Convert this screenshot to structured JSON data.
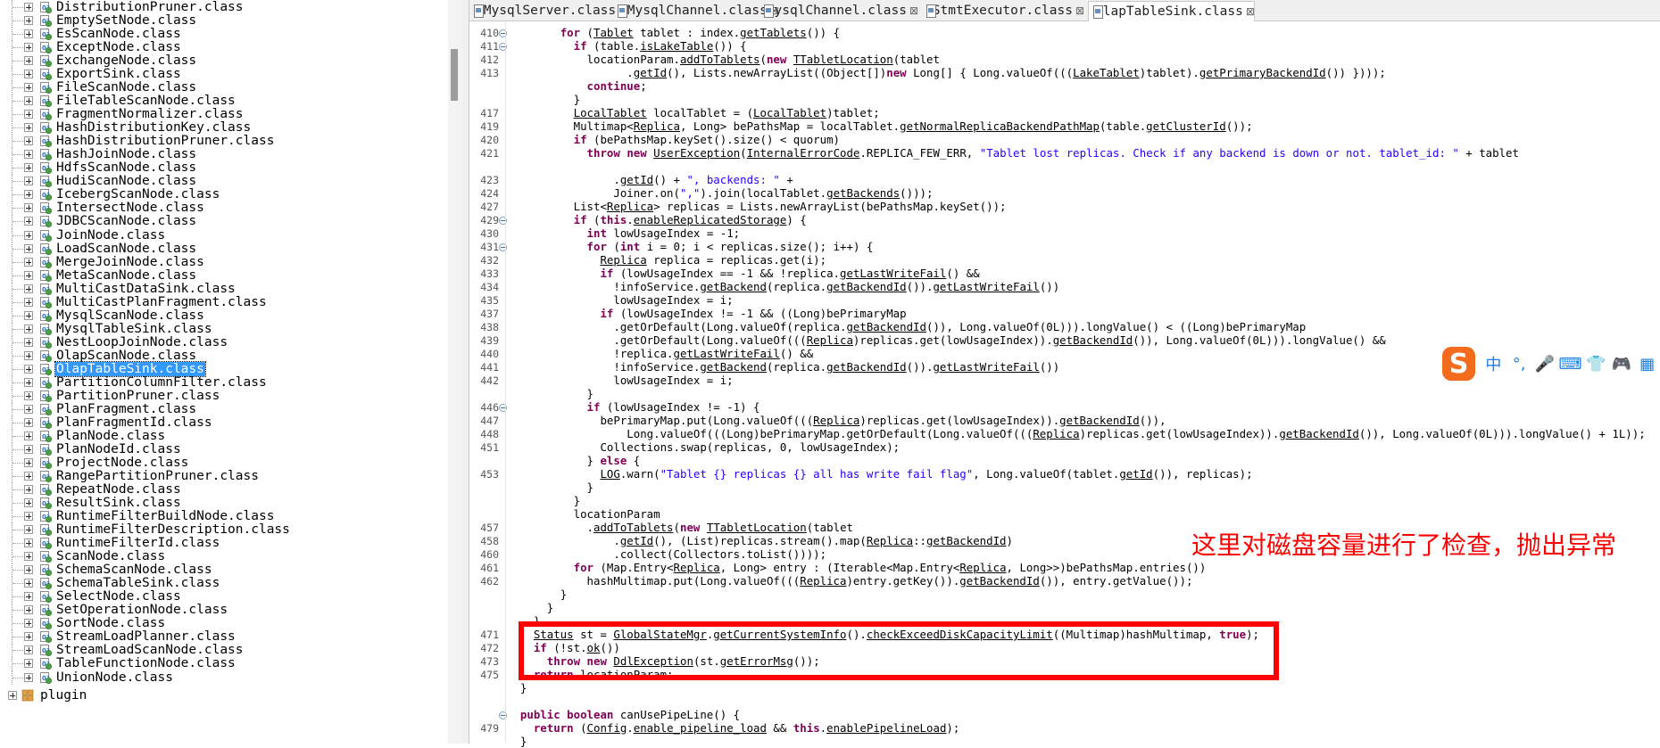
{
  "tree": {
    "items": [
      {
        "label": "DistributionPruner.class"
      },
      {
        "label": "EmptySetNode.class"
      },
      {
        "label": "EsScanNode.class"
      },
      {
        "label": "ExceptNode.class"
      },
      {
        "label": "ExchangeNode.class"
      },
      {
        "label": "ExportSink.class"
      },
      {
        "label": "FileScanNode.class"
      },
      {
        "label": "FileTableScanNode.class"
      },
      {
        "label": "FragmentNormalizer.class"
      },
      {
        "label": "HashDistributionKey.class"
      },
      {
        "label": "HashDistributionPruner.class"
      },
      {
        "label": "HashJoinNode.class"
      },
      {
        "label": "HdfsScanNode.class"
      },
      {
        "label": "HudiScanNode.class"
      },
      {
        "label": "IcebergScanNode.class"
      },
      {
        "label": "IntersectNode.class"
      },
      {
        "label": "JDBCScanNode.class"
      },
      {
        "label": "JoinNode.class"
      },
      {
        "label": "LoadScanNode.class"
      },
      {
        "label": "MergeJoinNode.class"
      },
      {
        "label": "MetaScanNode.class"
      },
      {
        "label": "MultiCastDataSink.class"
      },
      {
        "label": "MultiCastPlanFragment.class"
      },
      {
        "label": "MysqlScanNode.class"
      },
      {
        "label": "MysqlTableSink.class"
      },
      {
        "label": "NestLoopJoinNode.class"
      },
      {
        "label": "OlapScanNode.class"
      },
      {
        "label": "OlapTableSink.class",
        "selected": true
      },
      {
        "label": "PartitionColumnFilter.class"
      },
      {
        "label": "PartitionPruner.class"
      },
      {
        "label": "PlanFragment.class"
      },
      {
        "label": "PlanFragmentId.class"
      },
      {
        "label": "PlanNode.class"
      },
      {
        "label": "PlanNodeId.class"
      },
      {
        "label": "ProjectNode.class"
      },
      {
        "label": "RangePartitionPruner.class"
      },
      {
        "label": "RepeatNode.class"
      },
      {
        "label": "ResultSink.class"
      },
      {
        "label": "RuntimeFilterBuildNode.class"
      },
      {
        "label": "RuntimeFilterDescription.class"
      },
      {
        "label": "RuntimeFilterId.class"
      },
      {
        "label": "ScanNode.class"
      },
      {
        "label": "SchemaScanNode.class"
      },
      {
        "label": "SchemaTableSink.class"
      },
      {
        "label": "SelectNode.class"
      },
      {
        "label": "SetOperationNode.class"
      },
      {
        "label": "SortNode.class"
      },
      {
        "label": "StreamLoadPlanner.class"
      },
      {
        "label": "StreamLoadScanNode.class"
      },
      {
        "label": "TableFunctionNode.class"
      },
      {
        "label": "UnionNode.class"
      }
    ],
    "plugin_label": "plugin"
  },
  "tabs": [
    {
      "label": "NMysqlServer.class"
    },
    {
      "label": "NMysqlChannel.class"
    },
    {
      "label": "MysqlChannel.class"
    },
    {
      "label": "StmtExecutor.class"
    },
    {
      "label": "OlapTableSink.class",
      "active": true
    }
  ],
  "editor": {
    "lines": [
      {
        "n": "410",
        "fold": true,
        "ind": "        ",
        "t": [
          [
            "kw",
            "for"
          ],
          " (",
          [
            "u",
            "Tablet"
          ],
          " tablet : index.",
          [
            "u",
            "getTablets"
          ],
          "()) {"
        ]
      },
      {
        "n": "411",
        "fold": true,
        "ind": "          ",
        "t": [
          [
            "kw",
            "if"
          ],
          " (table.",
          [
            "u",
            "isLakeTable"
          ],
          "()) {"
        ]
      },
      {
        "n": "412",
        "ind": "            ",
        "t": [
          "locationParam.",
          [
            "u",
            "addToTablets"
          ],
          "(",
          [
            "kw",
            "new"
          ],
          " ",
          [
            "u",
            "TTabletLocation"
          ],
          "(tablet"
        ]
      },
      {
        "n": "413",
        "ind": "                  ",
        "t": [
          ".",
          [
            "u",
            "getId"
          ],
          "(), Lists.newArrayList((Object[])",
          [
            "kw",
            "new"
          ],
          " Long[] { Long.valueOf(((",
          [
            "u",
            "LakeTablet"
          ],
          ")tablet).",
          [
            "u",
            "getPrimaryBackendId"
          ],
          "()) })));"
        ]
      },
      {
        "n": "",
        "ind": "            ",
        "t": [
          [
            "kw",
            "continue"
          ],
          ";"
        ]
      },
      {
        "n": "",
        "ind": "          ",
        "t": [
          "}"
        ]
      },
      {
        "n": "417",
        "ind": "          ",
        "t": [
          [
            "u",
            "LocalTablet"
          ],
          " localTablet = (",
          [
            "u",
            "LocalTablet"
          ],
          ")tablet;"
        ]
      },
      {
        "n": "419",
        "ind": "          ",
        "t": [
          "Multimap<",
          [
            "u",
            "Replica"
          ],
          ", Long> bePathsMap = localTablet.",
          [
            "u",
            "getNormalReplicaBackendPathMap"
          ],
          "(table.",
          [
            "u",
            "getClusterId"
          ],
          "());"
        ]
      },
      {
        "n": "420",
        "ind": "          ",
        "t": [
          [
            "kw",
            "if"
          ],
          " (bePathsMap.keySet().size() < quorum)"
        ]
      },
      {
        "n": "421",
        "ind": "            ",
        "t": [
          [
            "kw",
            "throw"
          ],
          " ",
          [
            "kw",
            "new"
          ],
          " ",
          [
            "u",
            "UserException"
          ],
          "(",
          [
            "u",
            "InternalErrorCode"
          ],
          ".REPLICA_FEW_ERR, ",
          [
            "str",
            "\"Tablet lost replicas. Check if any backend is down or not. tablet_id: \""
          ],
          " + tablet"
        ]
      },
      {
        "n": "",
        "ind": "",
        "t": [
          ""
        ]
      },
      {
        "n": "423",
        "ind": "                ",
        "t": [
          ".",
          [
            "u",
            "getId"
          ],
          "() + ",
          [
            "str",
            "\", backends: \""
          ],
          " +"
        ]
      },
      {
        "n": "424",
        "ind": "                ",
        "t": [
          "Joiner.on(",
          [
            "str",
            "\",\""
          ],
          ").join(localTablet.",
          [
            "u",
            "getBackends"
          ],
          "()));"
        ]
      },
      {
        "n": "427",
        "ind": "          ",
        "t": [
          "List<",
          [
            "u",
            "Replica"
          ],
          "> replicas = Lists.newArrayList(bePathsMap.keySet());"
        ]
      },
      {
        "n": "429",
        "fold": true,
        "ind": "          ",
        "t": [
          [
            "kw",
            "if"
          ],
          " (",
          [
            "kw",
            "this"
          ],
          ".",
          [
            "u",
            "enableReplicatedStorage"
          ],
          ") {"
        ]
      },
      {
        "n": "430",
        "ind": "            ",
        "t": [
          [
            "kw",
            "int"
          ],
          " lowUsageIndex = -1;"
        ]
      },
      {
        "n": "431",
        "fold": true,
        "ind": "            ",
        "t": [
          [
            "kw",
            "for"
          ],
          " (",
          [
            "kw",
            "int"
          ],
          " i = 0; i < replicas.size(); i++) {"
        ]
      },
      {
        "n": "432",
        "ind": "              ",
        "t": [
          [
            "u",
            "Replica"
          ],
          " replica = replicas.get(i);"
        ]
      },
      {
        "n": "433",
        "ind": "              ",
        "t": [
          [
            "kw",
            "if"
          ],
          " (lowUsageIndex == -1 && !replica.",
          [
            "u",
            "getLastWriteFail"
          ],
          "() &&"
        ]
      },
      {
        "n": "434",
        "ind": "                ",
        "t": [
          "!infoService.",
          [
            "u",
            "getBackend"
          ],
          "(replica.",
          [
            "u",
            "getBackendId"
          ],
          "()).",
          [
            "u",
            "getLastWriteFail"
          ],
          "())"
        ]
      },
      {
        "n": "435",
        "ind": "                ",
        "t": [
          "lowUsageIndex = i;"
        ]
      },
      {
        "n": "437",
        "ind": "              ",
        "t": [
          [
            "kw",
            "if"
          ],
          " (lowUsageIndex != -1 && ((Long)bePrimaryMap"
        ]
      },
      {
        "n": "438",
        "ind": "                ",
        "t": [
          ".getOrDefault(Long.valueOf(replica.",
          [
            "u",
            "getBackendId"
          ],
          "()), Long.valueOf(0L))).longValue() < ((Long)bePrimaryMap"
        ]
      },
      {
        "n": "439",
        "ind": "                ",
        "t": [
          ".getOrDefault(Long.valueOf(((",
          [
            "u",
            "Replica"
          ],
          ")replicas.get(lowUsageIndex)).",
          [
            "u",
            "getBackendId"
          ],
          "()), Long.valueOf(0L))).longValue() &&"
        ]
      },
      {
        "n": "440",
        "ind": "                ",
        "t": [
          "!replica.",
          [
            "u",
            "getLastWriteFail"
          ],
          "() &&"
        ]
      },
      {
        "n": "441",
        "ind": "                ",
        "t": [
          "!infoService.",
          [
            "u",
            "getBackend"
          ],
          "(replica.",
          [
            "u",
            "getBackendId"
          ],
          "()).",
          [
            "u",
            "getLastWriteFail"
          ],
          "())"
        ]
      },
      {
        "n": "442",
        "ind": "                ",
        "t": [
          "lowUsageIndex = i;"
        ]
      },
      {
        "n": "",
        "ind": "            ",
        "t": [
          "}"
        ]
      },
      {
        "n": "446",
        "fold": true,
        "ind": "            ",
        "t": [
          [
            "kw",
            "if"
          ],
          " (lowUsageIndex != -1) {"
        ]
      },
      {
        "n": "447",
        "ind": "              ",
        "t": [
          "bePrimaryMap.put(Long.valueOf(((",
          [
            "u",
            "Replica"
          ],
          ")replicas.get(lowUsageIndex)).",
          [
            "u",
            "getBackendId"
          ],
          "()),"
        ]
      },
      {
        "n": "448",
        "ind": "                  ",
        "t": [
          "Long.valueOf(((Long)bePrimaryMap.getOrDefault(Long.valueOf(((",
          [
            "u",
            "Replica"
          ],
          ")replicas.get(lowUsageIndex)).",
          [
            "u",
            "getBackendId"
          ],
          "()), Long.valueOf(0L))).longValue() + 1L));"
        ]
      },
      {
        "n": "451",
        "ind": "              ",
        "t": [
          "Collections.swap(replicas, 0, lowUsageIndex);"
        ]
      },
      {
        "n": "",
        "ind": "            ",
        "t": [
          "} ",
          [
            "kw",
            "else"
          ],
          " {"
        ]
      },
      {
        "n": "453",
        "ind": "              ",
        "t": [
          [
            "u",
            "LOG"
          ],
          ".warn(",
          [
            "str",
            "\"Tablet {} replicas {} all has write fail flag\""
          ],
          ", Long.valueOf(tablet.",
          [
            "u",
            "getId"
          ],
          "()), replicas);"
        ]
      },
      {
        "n": "",
        "ind": "            ",
        "t": [
          "}"
        ]
      },
      {
        "n": "",
        "ind": "          ",
        "t": [
          "}"
        ]
      },
      {
        "n": "",
        "ind": "          ",
        "t": [
          "locationParam"
        ]
      },
      {
        "n": "457",
        "ind": "            ",
        "t": [
          ".",
          [
            "u",
            "addToTablets"
          ],
          "(",
          [
            "kw",
            "new"
          ],
          " ",
          [
            "u",
            "TTabletLocation"
          ],
          "(tablet"
        ]
      },
      {
        "n": "458",
        "ind": "                ",
        "t": [
          ".",
          [
            "u",
            "getId"
          ],
          "(), (List)replicas.stream().map(",
          [
            "u",
            "Replica"
          ],
          "::",
          [
            "u",
            "getBackendId"
          ],
          ")"
        ]
      },
      {
        "n": "460",
        "ind": "                ",
        "t": [
          ".collect(Collectors.toList())));"
        ]
      },
      {
        "n": "461",
        "ind": "          ",
        "t": [
          [
            "kw",
            "for"
          ],
          " (Map.Entry<",
          [
            "u",
            "Replica"
          ],
          ", Long> entry : (Iterable<Map.Entry<",
          [
            "u",
            "Replica"
          ],
          ", Long>>)bePathsMap.entries())"
        ]
      },
      {
        "n": "462",
        "ind": "            ",
        "t": [
          "hashMultimap.put(Long.valueOf(((",
          [
            "u",
            "Replica"
          ],
          ")entry.getKey()).",
          [
            "u",
            "getBackendId"
          ],
          "()), entry.getValue());"
        ]
      },
      {
        "n": "",
        "ind": "        ",
        "t": [
          "}"
        ]
      },
      {
        "n": "",
        "ind": "      ",
        "t": [
          "}"
        ]
      },
      {
        "n": "",
        "ind": "    ",
        "t": [
          "}"
        ]
      },
      {
        "n": "471",
        "ind": "    ",
        "t": [
          [
            "u",
            "Status"
          ],
          " st = ",
          [
            "u",
            "GlobalStateMgr"
          ],
          ".",
          [
            "u",
            "getCurrentSystemInfo"
          ],
          "().",
          [
            "u",
            "checkExceedDiskCapacityLimit"
          ],
          "((Multimap)hashMultimap, ",
          [
            "kw",
            "true"
          ],
          ");"
        ]
      },
      {
        "n": "472",
        "ind": "    ",
        "t": [
          [
            "kw",
            "if"
          ],
          " (!st.",
          [
            "u",
            "ok"
          ],
          "())"
        ]
      },
      {
        "n": "473",
        "ind": "      ",
        "t": [
          [
            "kw",
            "throw"
          ],
          " ",
          [
            "kw",
            "new"
          ],
          " ",
          [
            "u",
            "DdlException"
          ],
          "(st.",
          [
            "u",
            "getErrorMsg"
          ],
          "());"
        ]
      },
      {
        "n": "475",
        "ind": "    ",
        "t": [
          [
            "kw",
            "return"
          ],
          " locationParam;"
        ]
      },
      {
        "n": "",
        "ind": "  ",
        "t": [
          "}"
        ]
      },
      {
        "n": "",
        "ind": "",
        "t": [
          ""
        ]
      },
      {
        "n": "",
        "fold": true,
        "ind": "  ",
        "t": [
          [
            "kw",
            "public"
          ],
          " ",
          [
            "kw",
            "boolean"
          ],
          " canUsePipeLine() {"
        ]
      },
      {
        "n": "479",
        "ind": "    ",
        "t": [
          [
            "kw",
            "return"
          ],
          " (",
          [
            "u",
            "Config"
          ],
          ".",
          [
            "u",
            "enable_pipeline_load"
          ],
          " && ",
          [
            "kw",
            "this"
          ],
          ".",
          [
            "u",
            "enablePipelineLoad"
          ],
          ");"
        ]
      },
      {
        "n": "",
        "ind": "  ",
        "t": [
          "}"
        ]
      }
    ]
  },
  "annotation": {
    "text": "这里对磁盘容量进行了检查，抛出异常"
  },
  "ime": {
    "logo": "S",
    "items": [
      "中",
      "°,",
      "🎤",
      "⌨",
      "👕",
      "🎮",
      "▦"
    ]
  },
  "colors": {
    "keyword": "#7f0055",
    "string": "#2a00ff",
    "highlight": "#ff0000",
    "selection": "#3399ff"
  }
}
